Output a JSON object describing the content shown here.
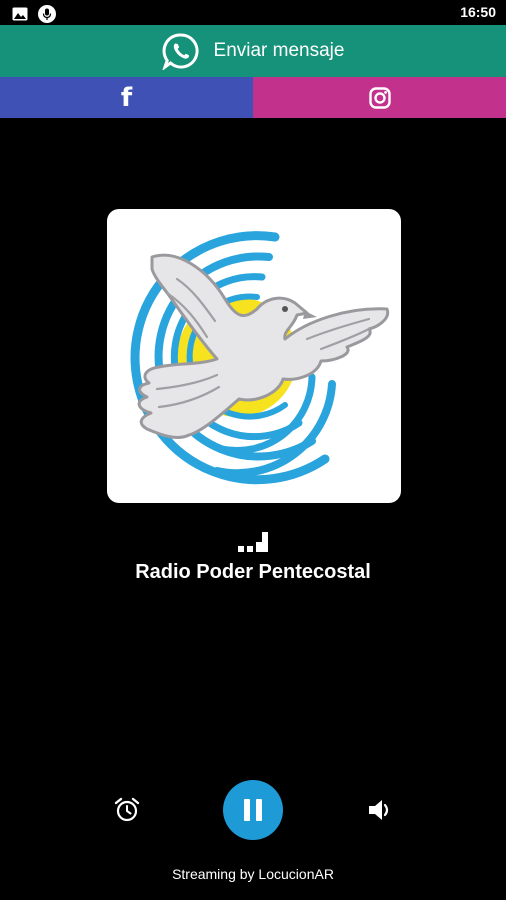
{
  "status_bar": {
    "time": "16:50"
  },
  "whatsapp": {
    "label": "Enviar mensaje",
    "icon": "whatsapp-icon",
    "color": "#16927a"
  },
  "social": {
    "facebook": {
      "icon": "facebook-icon",
      "letter": "f",
      "color": "#3f51b5"
    },
    "instagram": {
      "icon": "instagram-icon",
      "color": "#c2318c"
    }
  },
  "station": {
    "name": "Radio Poder Pentecostal",
    "logo": "dove-logo"
  },
  "controls": {
    "alarm_icon": "alarm-clock-icon",
    "play_state": "playing",
    "play_icon": "pause-icon",
    "play_color": "#1e9bd7",
    "volume_icon": "volume-icon"
  },
  "footer": {
    "text": "Streaming by LocucionAR"
  }
}
